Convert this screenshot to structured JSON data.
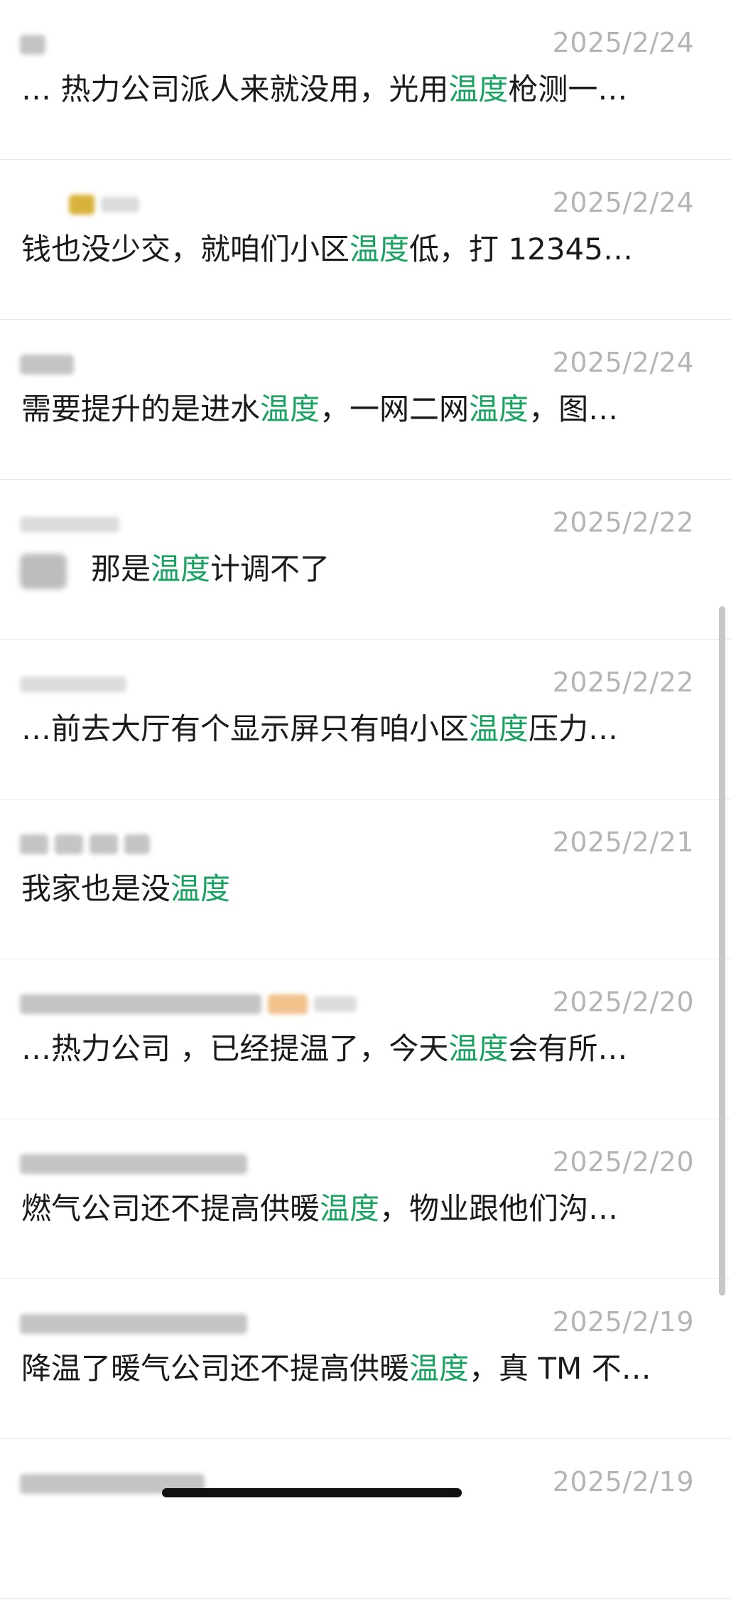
{
  "highlight_color": "#1aa260",
  "results": [
    {
      "date": "2025/2/24",
      "segments": [
        "… 热力公司派人来就没用，光用",
        "温度",
        "枪测一…"
      ],
      "sender_blocks": [
        {
          "w": 36,
          "t": "g"
        }
      ]
    },
    {
      "date": "2025/2/24",
      "segments": [
        "钱也没少交，就咱们小区",
        "温度",
        "低，打 12345…"
      ],
      "sender_blocks": [
        {
          "w": 60,
          "t": "pad"
        },
        {
          "w": 36,
          "t": "y"
        },
        {
          "w": 54,
          "t": "l"
        }
      ]
    },
    {
      "date": "2025/2/24",
      "segments": [
        "需要提升的是进水",
        "温度",
        "，一网二网",
        "温度",
        "，图…"
      ],
      "sender_blocks": [
        {
          "w": 76,
          "t": "g"
        }
      ]
    },
    {
      "date": "2025/2/22",
      "segments": [
        "那是",
        "温度",
        "计调不了"
      ],
      "avatar": true,
      "sender_blocks": [
        {
          "w": 140,
          "t": "l"
        }
      ]
    },
    {
      "date": "2025/2/22",
      "segments": [
        "…前去大厅有个显示屏只有咱小区",
        "温度",
        "压力…"
      ],
      "sender_blocks": [
        {
          "w": 150,
          "t": "l"
        }
      ]
    },
    {
      "date": "2025/2/21",
      "segments": [
        "我家也是没",
        "温度"
      ],
      "sender_blocks": [
        {
          "w": 40,
          "t": "g"
        },
        {
          "w": 40,
          "t": "g"
        },
        {
          "w": 40,
          "t": "g"
        },
        {
          "w": 36,
          "t": "g"
        }
      ]
    },
    {
      "date": "2025/2/20",
      "segments": [
        "…热力公司 ，已经提温了，今天",
        "温度",
        "会有所…"
      ],
      "sender_blocks": [
        {
          "w": 340,
          "t": "g"
        },
        {
          "w": 56,
          "t": "p"
        },
        {
          "w": 60,
          "t": "l"
        }
      ]
    },
    {
      "date": "2025/2/20",
      "segments": [
        "燃气公司还不提高供暖",
        "温度",
        "，物业跟他们沟…"
      ],
      "sender_blocks": [
        {
          "w": 320,
          "t": "g"
        }
      ]
    },
    {
      "date": "2025/2/19",
      "segments": [
        "降温了暖气公司还不提高供暖",
        "温度",
        "，真 TM 不…"
      ],
      "sender_blocks": [
        {
          "w": 320,
          "t": "g"
        }
      ]
    },
    {
      "date": "2025/2/19",
      "segments": [],
      "sender_blocks": [
        {
          "w": 260,
          "t": "g"
        }
      ]
    }
  ]
}
